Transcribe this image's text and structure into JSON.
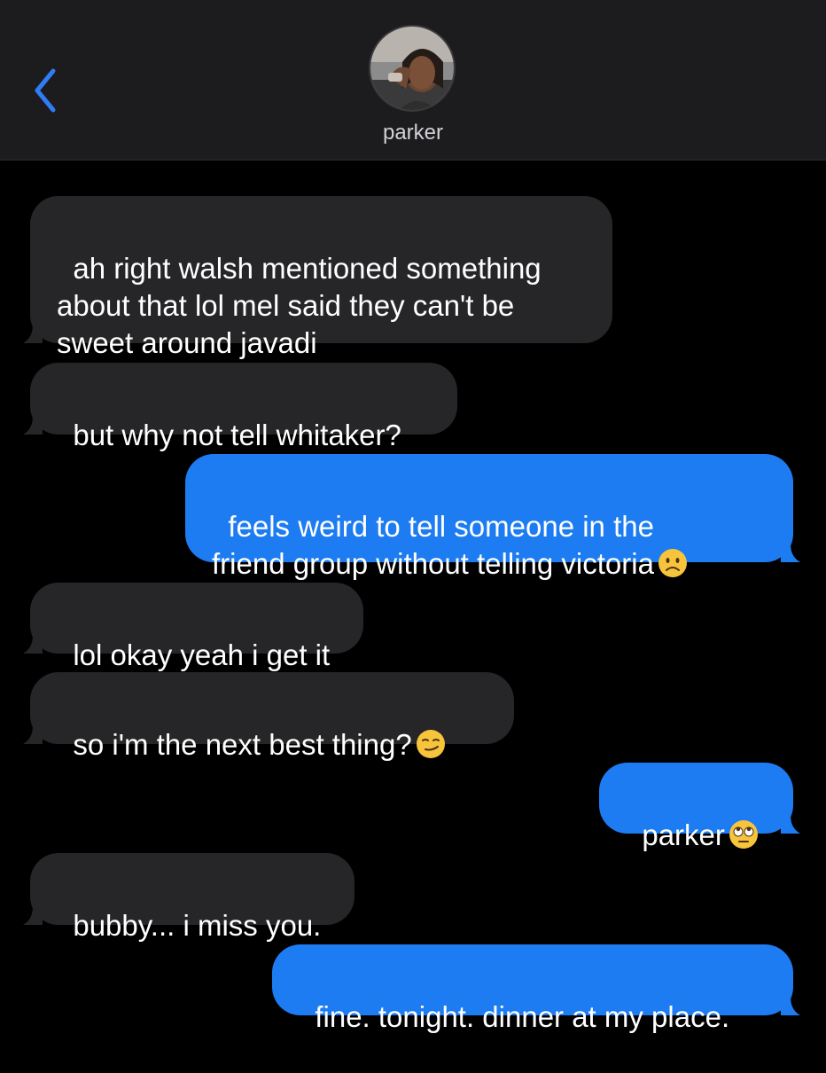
{
  "header": {
    "contact_name": "parker",
    "back_icon": "chevron-left-icon",
    "accent_color": "#2f7cf6"
  },
  "colors": {
    "incoming_bubble": "#262628",
    "outgoing_bubble": "#1d7cf2",
    "background": "#000000",
    "header_background": "#1c1c1e"
  },
  "messages": [
    {
      "direction": "incoming",
      "text": "ah right walsh mentioned something\nabout that lol mel said they can't be\nsweet around javadi"
    },
    {
      "direction": "incoming",
      "text": "but why not tell whitaker?"
    },
    {
      "direction": "outgoing",
      "text": "feels weird to tell someone in the\nfriend group without telling victoria",
      "emoji": "frowning-face-emoji"
    },
    {
      "direction": "incoming",
      "text": "lol okay yeah i get it"
    },
    {
      "direction": "incoming",
      "text": "so i'm the next best thing?",
      "emoji": "smirking-face-emoji"
    },
    {
      "direction": "outgoing",
      "text": "parker",
      "emoji": "eye-roll-face-emoji"
    },
    {
      "direction": "incoming",
      "text": "bubby... i miss you."
    },
    {
      "direction": "outgoing",
      "text": "fine. tonight. dinner at my place."
    }
  ]
}
